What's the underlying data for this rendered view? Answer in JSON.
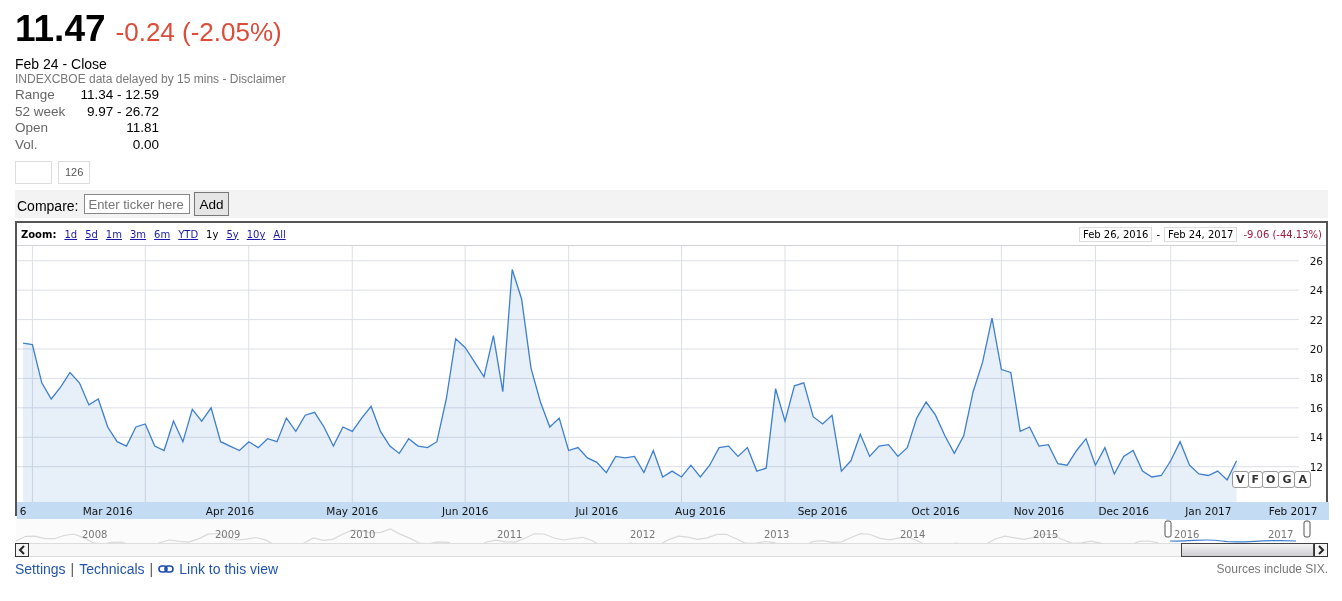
{
  "quote": {
    "price": "11.47",
    "change": "-0.24 (-2.05%)",
    "date_line": "Feb 24 - Close",
    "source_line": "INDEXCBOE data delayed by 15 mins - Disclaimer",
    "stats": [
      {
        "label": "Range",
        "value": "11.34 - 12.59"
      },
      {
        "label": "52 week",
        "value": "9.97 - 26.72"
      },
      {
        "label": "Open",
        "value": "11.81"
      },
      {
        "label": "Vol.",
        "value": "0.00"
      }
    ]
  },
  "share": {
    "count": "126"
  },
  "compare": {
    "label": "Compare:",
    "placeholder": "Enter ticker here",
    "button": "Add"
  },
  "zoom": {
    "label": "Zoom:",
    "options": [
      {
        "label": "1d",
        "selected": false
      },
      {
        "label": "5d",
        "selected": false
      },
      {
        "label": "1m",
        "selected": false
      },
      {
        "label": "3m",
        "selected": false
      },
      {
        "label": "6m",
        "selected": false
      },
      {
        "label": "YTD",
        "selected": false
      },
      {
        "label": "1y",
        "selected": true
      },
      {
        "label": "5y",
        "selected": false
      },
      {
        "label": "10y",
        "selected": false
      },
      {
        "label": "All",
        "selected": false
      }
    ]
  },
  "range": {
    "start": "Feb 26, 2016",
    "separator": "-",
    "end": "Feb 24, 2017",
    "change": "-9.06 (-44.13%)"
  },
  "chart": {
    "chart_data": {
      "type": "area",
      "grid": true,
      "ylim": [
        9.6,
        27
      ],
      "yticks": [
        12,
        14,
        16,
        18,
        20,
        22,
        24,
        26
      ],
      "categories": [
        "6",
        null,
        null,
        null,
        null,
        null,
        null,
        null,
        null,
        "Mar 2016",
        null,
        null,
        null,
        null,
        null,
        null,
        null,
        null,
        null,
        null,
        null,
        null,
        "Apr 2016",
        null,
        null,
        null,
        null,
        null,
        null,
        null,
        null,
        null,
        null,
        null,
        null,
        "May 2016",
        null,
        null,
        null,
        null,
        null,
        null,
        null,
        null,
        null,
        null,
        null,
        "Jun 2016",
        null,
        null,
        null,
        null,
        null,
        null,
        null,
        null,
        null,
        null,
        null,
        null,
        null,
        "Jul 2016",
        null,
        null,
        null,
        null,
        null,
        null,
        null,
        null,
        null,
        null,
        "Aug 2016",
        null,
        null,
        null,
        null,
        null,
        null,
        null,
        null,
        null,
        null,
        null,
        null,
        "Sep 2016",
        null,
        null,
        null,
        null,
        null,
        null,
        null,
        null,
        null,
        null,
        null,
        "Oct 2016",
        null,
        null,
        null,
        null,
        null,
        null,
        null,
        null,
        null,
        null,
        "Nov 2016",
        null,
        null,
        null,
        null,
        null,
        null,
        null,
        null,
        "Dec 2016",
        null,
        null,
        null,
        null,
        null,
        null,
        null,
        null,
        "Jan 2017",
        null,
        null,
        null,
        null,
        null,
        null,
        null,
        null,
        "Feb 2017"
      ],
      "series": [
        {
          "color": "#3d7fcf",
          "values": [
            20.4,
            20.3,
            17.7,
            16.6,
            17.4,
            18.4,
            17.7,
            16.2,
            16.6,
            14.7,
            13.7,
            13.4,
            14.7,
            14.9,
            13.4,
            13.1,
            15.1,
            13.7,
            15.9,
            15.1,
            16.0,
            13.7,
            13.4,
            13.1,
            13.7,
            13.3,
            13.9,
            13.7,
            15.3,
            14.4,
            15.5,
            15.7,
            14.7,
            13.4,
            14.7,
            14.4,
            15.3,
            16.1,
            14.4,
            13.4,
            12.9,
            13.9,
            13.4,
            13.3,
            13.7,
            16.6,
            20.7,
            20.1,
            19.1,
            18.1,
            20.9,
            17.1,
            25.4,
            23.4,
            18.7,
            16.4,
            14.7,
            15.3,
            13.1,
            13.3,
            12.6,
            12.3,
            11.6,
            12.7,
            12.6,
            12.7,
            11.6,
            13.1,
            11.3,
            11.7,
            11.3,
            12.1,
            11.3,
            12.1,
            13.3,
            13.4,
            12.7,
            13.3,
            11.7,
            11.9,
            17.3,
            15.1,
            17.5,
            17.7,
            15.4,
            14.9,
            15.5,
            11.7,
            12.4,
            14.2,
            12.7,
            13.4,
            13.5,
            12.7,
            13.3,
            15.3,
            16.4,
            15.5,
            14.1,
            12.9,
            14.1,
            17.1,
            19.1,
            22.1,
            18.6,
            18.4,
            14.4,
            14.7,
            13.4,
            13.5,
            12.2,
            12.1,
            13.1,
            13.9,
            12.1,
            13.3,
            11.5,
            12.7,
            13.1,
            11.7,
            11.3,
            11.4,
            12.4,
            13.7,
            12.1,
            11.5,
            11.4,
            11.7,
            11.1,
            12.4,
            null,
            null,
            null,
            null,
            null,
            null
          ]
        }
      ]
    },
    "flags": [
      {
        "label": "V"
      },
      {
        "label": "F"
      },
      {
        "label": "O"
      },
      {
        "label": "G"
      },
      {
        "label": "A"
      }
    ]
  },
  "navigator": {
    "years": [
      "2008",
      "2009",
      "2010",
      "2011",
      "2012",
      "2013",
      "2014",
      "2015",
      "2016",
      "2017"
    ]
  },
  "footer": {
    "links": [
      {
        "label": "Settings",
        "separator": "|"
      },
      {
        "label": "Technicals",
        "separator": "|"
      }
    ],
    "view_link": "Link to this view",
    "sources": "Sources include SIX."
  }
}
